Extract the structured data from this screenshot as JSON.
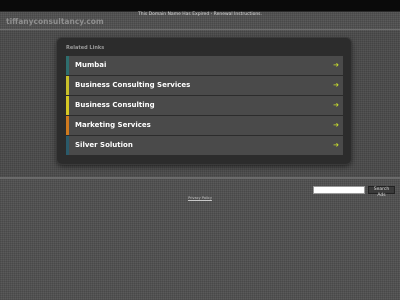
{
  "top_bar": {
    "notice": "This Domain Name Has Expired - Renewal Instructions."
  },
  "site": {
    "domain": "tiffanyconsultancy.com"
  },
  "related": {
    "title": "Related Links",
    "links": [
      {
        "label": "Mumbai",
        "accent": "#2e6e6e"
      },
      {
        "label": "Business Consulting Services",
        "accent": "#c9c02a"
      },
      {
        "label": "Business Consulting",
        "accent": "#d6c824"
      },
      {
        "label": "Marketing Services",
        "accent": "#d07a1e"
      },
      {
        "label": "Silver Solution",
        "accent": "#2a5a6a"
      }
    ],
    "arrow_icon": "arrow-right-icon",
    "arrow_color": "#c4d92e"
  },
  "search": {
    "input_value": "",
    "button_label": "Search Ads"
  },
  "footer": {
    "privacy_label": "Privacy Policy"
  }
}
